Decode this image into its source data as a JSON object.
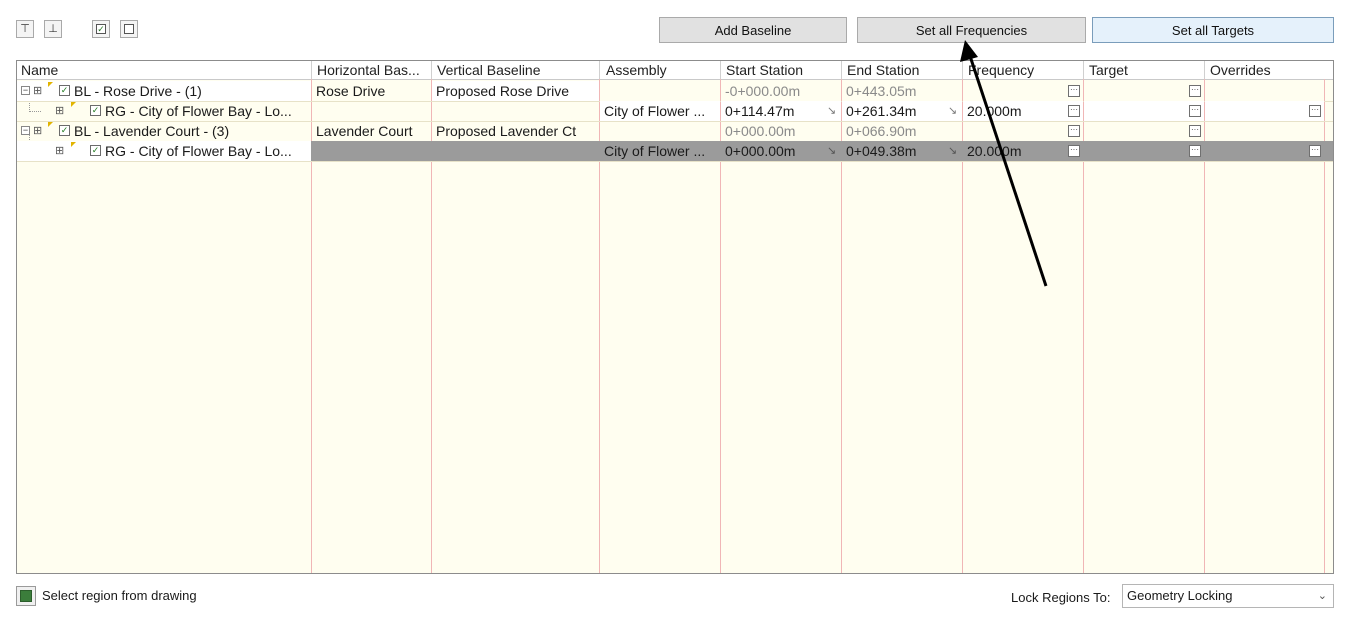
{
  "toolbar": {
    "add_baseline": "Add Baseline",
    "set_all_frequencies": "Set all Frequencies",
    "set_all_targets": "Set all Targets"
  },
  "grid": {
    "columns": [
      "Name",
      "Horizontal Bas...",
      "Vertical Baseline",
      "Assembly",
      "Start Station",
      "End Station",
      "Frequency",
      "Target",
      "Overrides"
    ],
    "rows": [
      {
        "name": "BL - Rose Drive - (1)",
        "horizontal": "Rose Drive",
        "vertical": "Proposed Rose Drive",
        "assembly": "",
        "start": "-0+000.00m",
        "end": "0+443.05m",
        "frequency": "",
        "target": "",
        "overrides": ""
      },
      {
        "name": "RG - City of Flower Bay - Lo...",
        "horizontal": "",
        "vertical": "",
        "assembly": "City of Flower ...",
        "start": "0+114.47m",
        "end": "0+261.34m",
        "frequency": "20.000m",
        "target": "",
        "overrides": ""
      },
      {
        "name": "BL - Lavender Court - (3)",
        "horizontal": "Lavender Court",
        "vertical": "Proposed Lavender Ct",
        "assembly": "",
        "start": "0+000.00m",
        "end": "0+066.90m",
        "frequency": "",
        "target": "",
        "overrides": ""
      },
      {
        "name": "RG - City of Flower Bay - Lo...",
        "horizontal": "",
        "vertical": "",
        "assembly": "City of Flower ...",
        "start": "0+000.00m",
        "end": "0+049.38m",
        "frequency": "20.000m",
        "target": "",
        "overrides": ""
      }
    ]
  },
  "footer": {
    "select_region": "Select region from drawing",
    "lock_label": "Lock Regions To:",
    "lock_value": "Geometry Locking"
  },
  "icons": {
    "checkbox": "☑",
    "ellipsis": "···",
    "chevron": "⌵"
  }
}
